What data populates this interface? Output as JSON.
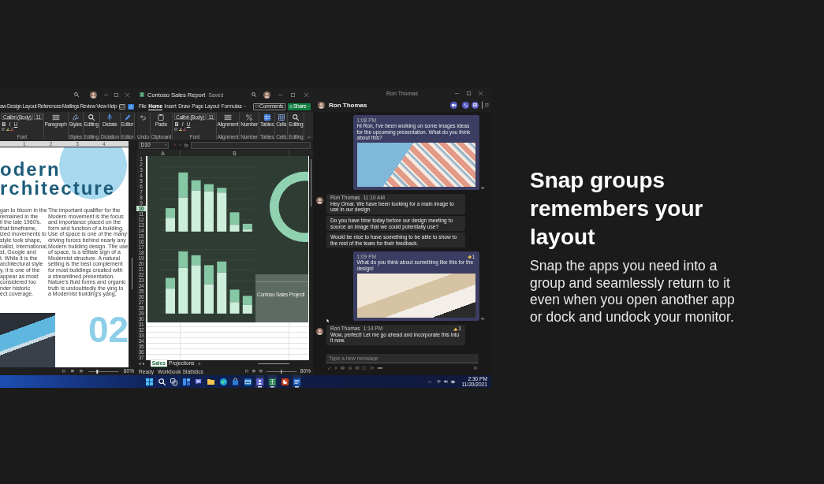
{
  "word": {
    "tabs": [
      {
        "label": "aw",
        "selected": false
      },
      {
        "label": "Design",
        "selected": false
      },
      {
        "label": "Layout",
        "selected": false
      },
      {
        "label": "References",
        "selected": false
      },
      {
        "label": "Mailings",
        "selected": false
      },
      {
        "label": "Review",
        "selected": false
      },
      {
        "label": "View",
        "selected": false
      },
      {
        "label": "Help",
        "selected": false
      }
    ],
    "ribbon": {
      "font_name": "Calibri (Body)",
      "font_size": "11",
      "format_buttons": [
        "B",
        "I",
        "U"
      ],
      "groups": [
        {
          "kind": "font",
          "label": "Font"
        },
        {
          "kind": "lines",
          "button": "Paragraph"
        },
        {
          "kind": "squiggle",
          "button": "Styles",
          "label": "Styles"
        },
        {
          "kind": "search",
          "button": "Editing",
          "label": "Editing"
        },
        {
          "kind": "microphone",
          "button": "Dictate",
          "label": "Dictation"
        },
        {
          "kind": "pen",
          "button": "Editor",
          "label": "Editor"
        }
      ]
    },
    "ruler": [
      "1",
      "2",
      "3",
      "4"
    ],
    "document": {
      "heading_lines": [
        "odern",
        "rchitecture"
      ],
      "column_1": [
        "gan to bloom in the",
        "remained in the",
        "il the late 1960's.",
        "that timeframe,",
        "ized movements to",
        "style took shape,",
        "nalist, International,",
        "st, Googie and",
        "t. While it is the",
        "architectural style",
        "y, it is one of the",
        "appear as most",
        "considered too",
        "nder historic",
        "ect coverage."
      ],
      "column_2": [
        "The important qualifier for the",
        "Modern movement is the focus",
        "and importance placed on the",
        "form and function of a building.",
        "Use of space is one of the many",
        "driving forces behind nearly any",
        "Modern building design. The use",
        "of space, is a telltale sign of a",
        "Modernist structure. A natural",
        "setting is the best complement",
        "for most buildings created with",
        "a streamlined presentation.",
        "Nature's fluid forms and organic",
        "truth is undoubtedly the ying to",
        "a Modernist building's yang."
      ],
      "number": "02"
    },
    "status": {
      "zoom": "80%",
      "zoom_slider": {
        "level": 0.3
      }
    }
  },
  "excel": {
    "title": "Contoso Sales Report",
    "save_state": "Saved",
    "tabs": [
      {
        "label": "File",
        "selected": false
      },
      {
        "label": "Home",
        "selected": true
      },
      {
        "label": "Insert",
        "selected": false
      },
      {
        "label": "Draw",
        "selected": false
      },
      {
        "label": "Page Layout",
        "selected": false
      },
      {
        "label": "Formulas",
        "selected": false
      }
    ],
    "comments_button": "Comments",
    "share_button": "Share",
    "ribbon": {
      "font_name": "Calibri (Body)",
      "font_size": "11",
      "format_buttons": [
        "B",
        "I",
        "U"
      ],
      "groups": [
        {
          "kind": "undo",
          "label": "Undo"
        },
        {
          "kind": "clipboard",
          "button": "Paste",
          "label": "Clipboard"
        },
        {
          "kind": "font",
          "label": "Font"
        },
        {
          "kind": "lines",
          "button": "Alignment",
          "label": "Alignment"
        },
        {
          "kind": "percent",
          "button": "Number",
          "label": "Number"
        },
        {
          "kind": "table",
          "button": "Tables",
          "label": "Tables"
        },
        {
          "kind": "grid",
          "button": "Cells",
          "label": "Cells"
        },
        {
          "kind": "search",
          "button": "Editing",
          "label": "Editing"
        }
      ]
    },
    "name_box": "D10",
    "function_label": "fx",
    "columns": [
      "A",
      "B"
    ],
    "rows": [
      {
        "label": "1",
        "selected": false
      },
      {
        "label": "2",
        "selected": false
      },
      {
        "label": "3",
        "selected": false
      },
      {
        "label": "4",
        "selected": false
      },
      {
        "label": "5",
        "selected": false
      },
      {
        "label": "6",
        "selected": false
      },
      {
        "label": "7",
        "selected": false
      },
      {
        "label": "8",
        "selected": false
      },
      {
        "label": "9",
        "selected": false
      },
      {
        "label": "10",
        "selected": true
      },
      {
        "label": "11",
        "selected": false
      },
      {
        "label": "12",
        "selected": false
      },
      {
        "label": "13",
        "selected": false
      },
      {
        "label": "14",
        "selected": false
      },
      {
        "label": "15",
        "selected": false
      },
      {
        "label": "16",
        "selected": false
      },
      {
        "label": "17",
        "selected": false
      },
      {
        "label": "18",
        "selected": false
      },
      {
        "label": "19",
        "selected": false
      },
      {
        "label": "20",
        "selected": false
      },
      {
        "label": "21",
        "selected": false
      },
      {
        "label": "22",
        "selected": false
      },
      {
        "label": "23",
        "selected": false
      },
      {
        "label": "24",
        "selected": false
      },
      {
        "label": "25",
        "selected": false
      },
      {
        "label": "26",
        "selected": false
      },
      {
        "label": "27",
        "selected": false
      },
      {
        "label": "28",
        "selected": false
      },
      {
        "label": "29",
        "selected": false
      },
      {
        "label": "30",
        "selected": false
      },
      {
        "label": "31",
        "selected": false
      },
      {
        "label": "32",
        "selected": false
      },
      {
        "label": "33",
        "selected": false
      },
      {
        "label": "34",
        "selected": false
      },
      {
        "label": "35",
        "selected": false
      },
      {
        "label": "36",
        "selected": false
      },
      {
        "label": "37",
        "selected": false
      }
    ],
    "chart": {
      "panel_title": "Contoso Sales Projecti"
    },
    "sheets": [
      {
        "label": "Sales",
        "selected": true
      },
      {
        "label": "Projections",
        "selected": false
      }
    ],
    "status": {
      "ready": "Ready",
      "statistics": "Workbook Statistics",
      "zoom": "80%",
      "zoom_slider": {
        "level": 0.5
      }
    }
  },
  "teams": {
    "window_title": "Ron Thomas",
    "contact": "Ron Thomas",
    "messages": [
      {
        "kind": "sent",
        "time": "1:08 PM",
        "text": "Hi Ron, I've been working on some images ideas for the upcoming presentation. What do you think about this?",
        "photo": true
      },
      {
        "kind": "received",
        "avatar": true,
        "sender": "Ron Thomas",
        "time": "11:10 AM",
        "text": "Hey Omar. We have been looking for a main image to use in our design"
      },
      {
        "kind": "received",
        "avatar": false,
        "text": "Do you have time today before our design meeting to source an image that we could potentially use?"
      },
      {
        "kind": "received",
        "avatar": false,
        "text": "Would be nice to have something to be able to show to the rest of the team for their feedback."
      },
      {
        "kind": "sent",
        "time": "1:09 PM",
        "reaction_count": "1",
        "text": "What do you think about something like this for the design!",
        "photo": true
      },
      {
        "kind": "received",
        "avatar": true,
        "sender": "Ron Thomas",
        "time": "1:14 PM",
        "reaction_count": "1",
        "text": "Wow, perfect! Let me go ahead and incorporate this into it now."
      }
    ],
    "compose": {
      "placeholder": "Type a new message"
    }
  },
  "taskbar": {
    "apps": [
      {
        "kind": "start",
        "open": false
      },
      {
        "kind": "search",
        "open": false
      },
      {
        "kind": "taskview",
        "open": false
      },
      {
        "kind": "widgets",
        "open": false
      },
      {
        "kind": "chat",
        "open": false
      },
      {
        "kind": "folder",
        "open": false
      },
      {
        "kind": "browser",
        "open": false
      },
      {
        "kind": "store",
        "open": false
      },
      {
        "kind": "mail",
        "open": false
      },
      {
        "kind": "people",
        "open": true
      },
      {
        "kind": "spreadsheet",
        "open": true
      },
      {
        "kind": "presentation",
        "open": false
      },
      {
        "kind": "document",
        "open": true
      }
    ],
    "time": "2:30 PM",
    "date": "11/20/2021"
  },
  "promo": {
    "heading": "Snap groups remembers your layout",
    "body": "Snap the apps you need into a group and seamlessly return to it even when you open another app or dock and undock your monitor."
  }
}
